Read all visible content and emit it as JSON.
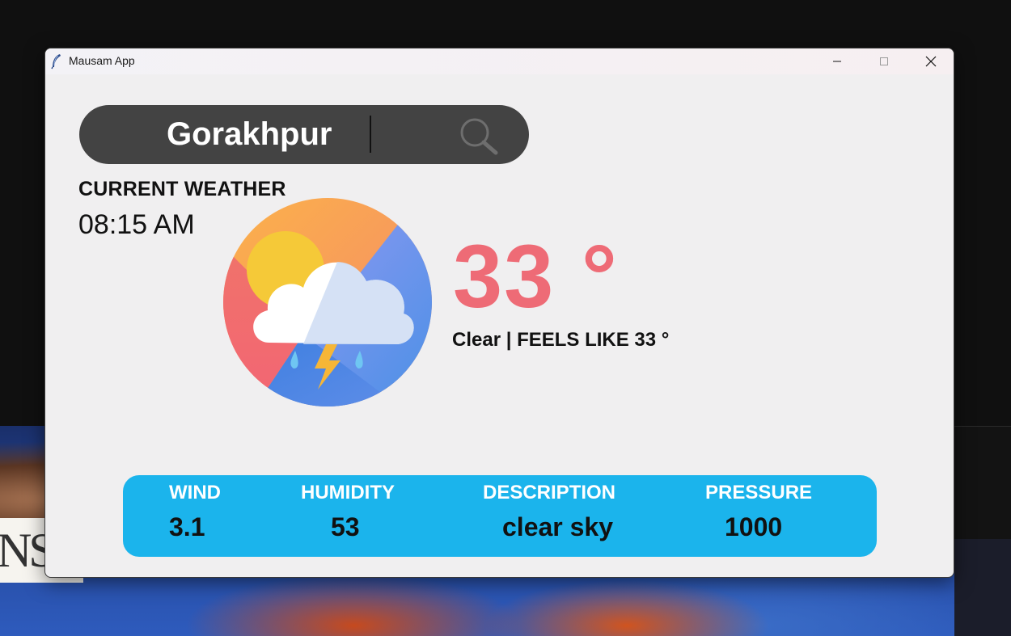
{
  "window": {
    "title": "Mausam App"
  },
  "search": {
    "value": "Gorakhpur"
  },
  "current": {
    "label": "CURRENT WEATHER",
    "time": "08:15 AM",
    "temperature": "33 °",
    "feels_like": "Clear | FEELS LIKE 33 °",
    "icon": "sun-cloud-thunder-icon"
  },
  "info": {
    "wind_label": "WIND",
    "wind_value": "3.1",
    "humidity_label": "HUMIDITY",
    "humidity_value": "53",
    "description_label": "DESCRIPTION",
    "description_value": "clear sky",
    "pressure_label": "PRESSURE",
    "pressure_value": "1000"
  },
  "background": {
    "partial_text": "NS"
  },
  "colors": {
    "temperature": "#ee6b76",
    "info_bar": "#1bb4ec",
    "search_bar": "#434343"
  }
}
